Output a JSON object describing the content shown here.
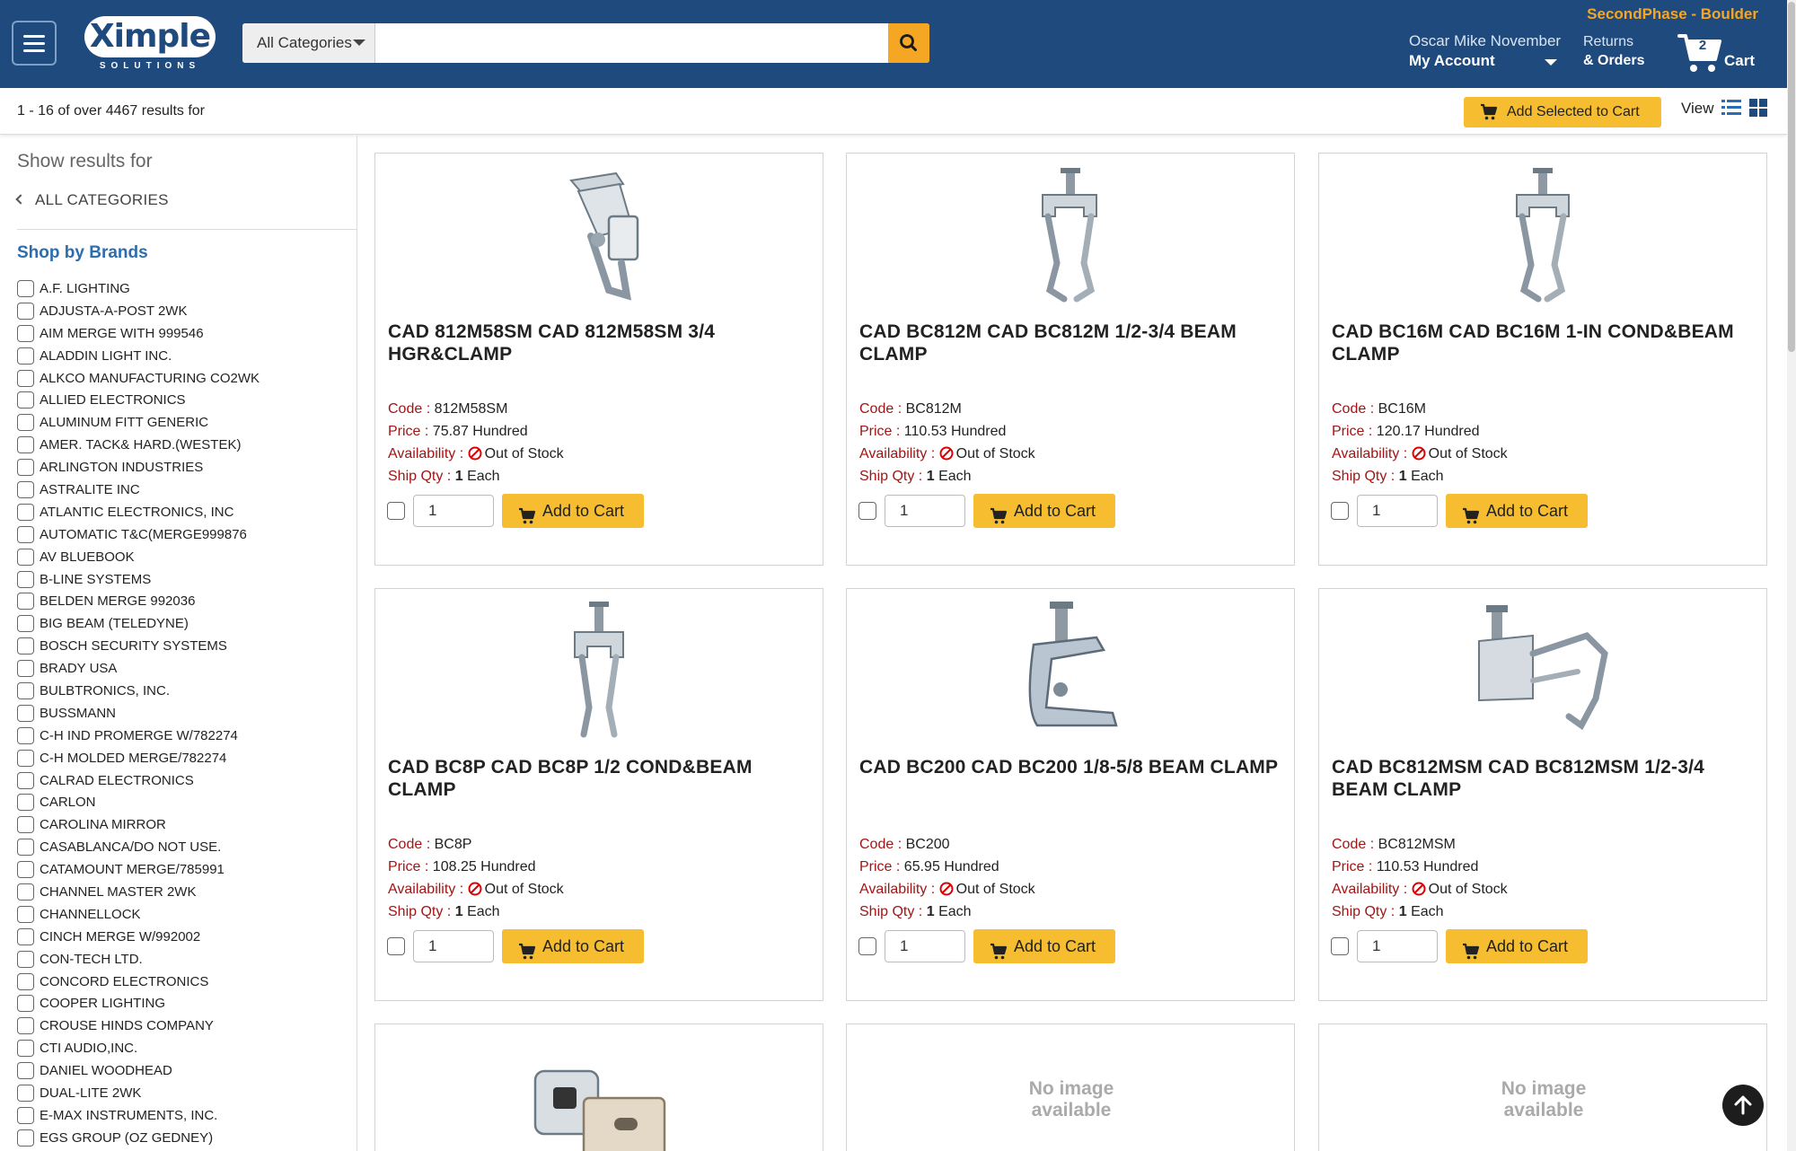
{
  "header": {
    "logo_word": "Ximple",
    "logo_sub": "SOLUTIONS",
    "search_category": "All Categories",
    "search_placeholder": "",
    "site_name": "SecondPhase - Boulder",
    "user_name": "Oscar Mike November",
    "account_label": "My Account",
    "returns_line1": "Returns",
    "returns_line2": "& Orders",
    "cart_count": "2",
    "cart_label": "Cart"
  },
  "results": {
    "summary": "1 - 16 of over 4467 results for",
    "add_selected_label": "Add Selected to Cart",
    "view_label": "View"
  },
  "sidebar": {
    "title": "Show results for",
    "all_categories": "ALL CATEGORIES",
    "brands_title": "Shop by Brands",
    "brands": [
      "A.F. LIGHTING",
      "ADJUSTA-A-POST 2WK",
      "AIM MERGE WITH 999546",
      "ALADDIN LIGHT INC.",
      "ALKCO MANUFACTURING CO2WK",
      "ALLIED ELECTRONICS",
      "ALUMINUM FITT GENERIC",
      "AMER. TACK& HARD.(WESTEK)",
      "ARLINGTON INDUSTRIES",
      "ASTRALITE INC",
      "ATLANTIC ELECTRONICS, INC",
      "AUTOMATIC T&C(MERGE999876",
      "AV BLUEBOOK",
      "B-LINE SYSTEMS",
      "BELDEN MERGE 992036",
      "BIG BEAM (TELEDYNE)",
      "BOSCH SECURITY SYSTEMS",
      "BRADY USA",
      "BULBTRONICS, INC.",
      "BUSSMANN",
      "C-H IND PROMERGE W/782274",
      "C-H MOLDED MERGE/782274",
      "CALRAD ELECTRONICS",
      "CARLON",
      "CAROLINA MIRROR",
      "CASABLANCA/DO NOT USE.",
      "CATAMOUNT MERGE/785991",
      "CHANNEL MASTER 2WK",
      "CHANNELLOCK",
      "CINCH MERGE W/992002",
      "CON-TECH LTD.",
      "CONCORD ELECTRONICS",
      "COOPER LIGHTING",
      "CROUSE HINDS COMPANY",
      "CTI AUDIO,INC.",
      "DANIEL WOODHEAD",
      "DUAL-LITE 2WK",
      "E-MAX INSTRUMENTS, INC.",
      "EGS GROUP (OZ GEDNEY)"
    ]
  },
  "labels": {
    "code": "Code :",
    "price": "Price :",
    "availability": "Availability :",
    "ship_qty": "Ship Qty :",
    "add_to_cart": "Add to Cart",
    "no_image": "No image available"
  },
  "products": [
    {
      "title": "CAD 812M58SM CAD 812M58SM 3/4 HGR&CLAMP",
      "code": "812M58SM",
      "price": "75.87 Hundred",
      "availability": "Out of Stock",
      "ship_qty": "1",
      "ship_unit": "Each",
      "qty": "1"
    },
    {
      "title": "CAD BC812M CAD BC812M 1/2-3/4 BEAM CLAMP",
      "code": "BC812M",
      "price": "110.53 Hundred",
      "availability": "Out of Stock",
      "ship_qty": "1",
      "ship_unit": "Each",
      "qty": "1"
    },
    {
      "title": "CAD BC16M CAD BC16M 1-IN COND&BEAM CLAMP",
      "code": "BC16M",
      "price": "120.17 Hundred",
      "availability": "Out of Stock",
      "ship_qty": "1",
      "ship_unit": "Each",
      "qty": "1"
    },
    {
      "title": "CAD BC8P CAD BC8P 1/2 COND&BEAM CLAMP",
      "code": "BC8P",
      "price": "108.25 Hundred",
      "availability": "Out of Stock",
      "ship_qty": "1",
      "ship_unit": "Each",
      "qty": "1"
    },
    {
      "title": "CAD BC200 CAD BC200 1/8-5/8 BEAM CLAMP",
      "code": "BC200",
      "price": "65.95 Hundred",
      "availability": "Out of Stock",
      "ship_qty": "1",
      "ship_unit": "Each",
      "qty": "1"
    },
    {
      "title": "CAD BC812MSM CAD BC812MSM 1/2-3/4 BEAM CLAMP",
      "code": "BC812MSM",
      "price": "110.53 Hundred",
      "availability": "Out of Stock",
      "ship_qty": "1",
      "ship_unit": "Each",
      "qty": "1"
    }
  ],
  "colors": {
    "header_bg": "#1f4a7e",
    "accent": "#f5a623",
    "button": "#f5bd2f",
    "label_red": "#a31515",
    "brand_blue": "#2a6db0"
  }
}
